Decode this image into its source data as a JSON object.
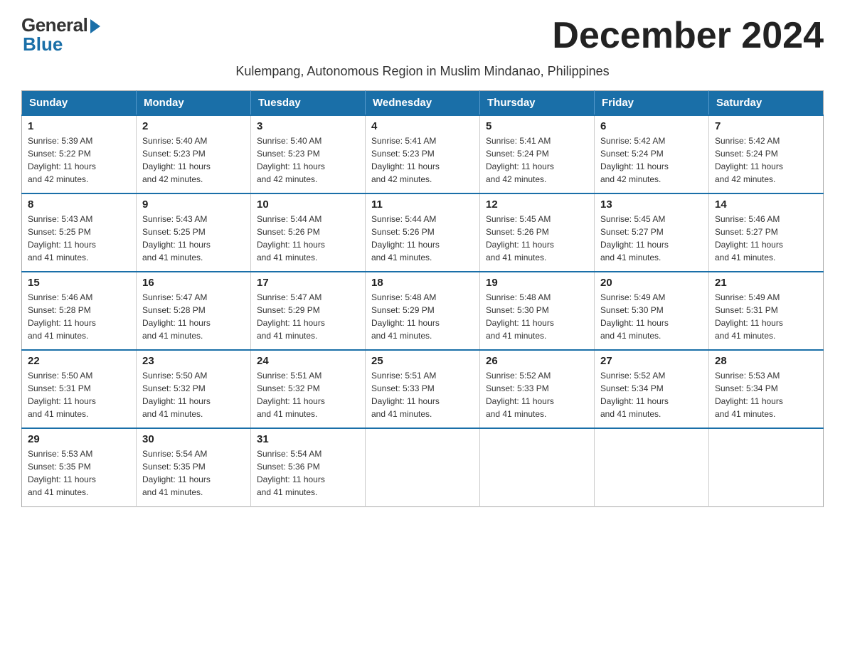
{
  "logo": {
    "general": "General",
    "blue": "Blue"
  },
  "title": "December 2024",
  "subtitle": "Kulempang, Autonomous Region in Muslim Mindanao, Philippines",
  "days_of_week": [
    "Sunday",
    "Monday",
    "Tuesday",
    "Wednesday",
    "Thursday",
    "Friday",
    "Saturday"
  ],
  "weeks": [
    [
      {
        "day": "1",
        "sunrise": "5:39 AM",
        "sunset": "5:22 PM",
        "daylight": "11 hours and 42 minutes."
      },
      {
        "day": "2",
        "sunrise": "5:40 AM",
        "sunset": "5:23 PM",
        "daylight": "11 hours and 42 minutes."
      },
      {
        "day": "3",
        "sunrise": "5:40 AM",
        "sunset": "5:23 PM",
        "daylight": "11 hours and 42 minutes."
      },
      {
        "day": "4",
        "sunrise": "5:41 AM",
        "sunset": "5:23 PM",
        "daylight": "11 hours and 42 minutes."
      },
      {
        "day": "5",
        "sunrise": "5:41 AM",
        "sunset": "5:24 PM",
        "daylight": "11 hours and 42 minutes."
      },
      {
        "day": "6",
        "sunrise": "5:42 AM",
        "sunset": "5:24 PM",
        "daylight": "11 hours and 42 minutes."
      },
      {
        "day": "7",
        "sunrise": "5:42 AM",
        "sunset": "5:24 PM",
        "daylight": "11 hours and 42 minutes."
      }
    ],
    [
      {
        "day": "8",
        "sunrise": "5:43 AM",
        "sunset": "5:25 PM",
        "daylight": "11 hours and 41 minutes."
      },
      {
        "day": "9",
        "sunrise": "5:43 AM",
        "sunset": "5:25 PM",
        "daylight": "11 hours and 41 minutes."
      },
      {
        "day": "10",
        "sunrise": "5:44 AM",
        "sunset": "5:26 PM",
        "daylight": "11 hours and 41 minutes."
      },
      {
        "day": "11",
        "sunrise": "5:44 AM",
        "sunset": "5:26 PM",
        "daylight": "11 hours and 41 minutes."
      },
      {
        "day": "12",
        "sunrise": "5:45 AM",
        "sunset": "5:26 PM",
        "daylight": "11 hours and 41 minutes."
      },
      {
        "day": "13",
        "sunrise": "5:45 AM",
        "sunset": "5:27 PM",
        "daylight": "11 hours and 41 minutes."
      },
      {
        "day": "14",
        "sunrise": "5:46 AM",
        "sunset": "5:27 PM",
        "daylight": "11 hours and 41 minutes."
      }
    ],
    [
      {
        "day": "15",
        "sunrise": "5:46 AM",
        "sunset": "5:28 PM",
        "daylight": "11 hours and 41 minutes."
      },
      {
        "day": "16",
        "sunrise": "5:47 AM",
        "sunset": "5:28 PM",
        "daylight": "11 hours and 41 minutes."
      },
      {
        "day": "17",
        "sunrise": "5:47 AM",
        "sunset": "5:29 PM",
        "daylight": "11 hours and 41 minutes."
      },
      {
        "day": "18",
        "sunrise": "5:48 AM",
        "sunset": "5:29 PM",
        "daylight": "11 hours and 41 minutes."
      },
      {
        "day": "19",
        "sunrise": "5:48 AM",
        "sunset": "5:30 PM",
        "daylight": "11 hours and 41 minutes."
      },
      {
        "day": "20",
        "sunrise": "5:49 AM",
        "sunset": "5:30 PM",
        "daylight": "11 hours and 41 minutes."
      },
      {
        "day": "21",
        "sunrise": "5:49 AM",
        "sunset": "5:31 PM",
        "daylight": "11 hours and 41 minutes."
      }
    ],
    [
      {
        "day": "22",
        "sunrise": "5:50 AM",
        "sunset": "5:31 PM",
        "daylight": "11 hours and 41 minutes."
      },
      {
        "day": "23",
        "sunrise": "5:50 AM",
        "sunset": "5:32 PM",
        "daylight": "11 hours and 41 minutes."
      },
      {
        "day": "24",
        "sunrise": "5:51 AM",
        "sunset": "5:32 PM",
        "daylight": "11 hours and 41 minutes."
      },
      {
        "day": "25",
        "sunrise": "5:51 AM",
        "sunset": "5:33 PM",
        "daylight": "11 hours and 41 minutes."
      },
      {
        "day": "26",
        "sunrise": "5:52 AM",
        "sunset": "5:33 PM",
        "daylight": "11 hours and 41 minutes."
      },
      {
        "day": "27",
        "sunrise": "5:52 AM",
        "sunset": "5:34 PM",
        "daylight": "11 hours and 41 minutes."
      },
      {
        "day": "28",
        "sunrise": "5:53 AM",
        "sunset": "5:34 PM",
        "daylight": "11 hours and 41 minutes."
      }
    ],
    [
      {
        "day": "29",
        "sunrise": "5:53 AM",
        "sunset": "5:35 PM",
        "daylight": "11 hours and 41 minutes."
      },
      {
        "day": "30",
        "sunrise": "5:54 AM",
        "sunset": "5:35 PM",
        "daylight": "11 hours and 41 minutes."
      },
      {
        "day": "31",
        "sunrise": "5:54 AM",
        "sunset": "5:36 PM",
        "daylight": "11 hours and 41 minutes."
      },
      null,
      null,
      null,
      null
    ]
  ],
  "labels": {
    "sunrise": "Sunrise:",
    "sunset": "Sunset:",
    "daylight": "Daylight:"
  }
}
